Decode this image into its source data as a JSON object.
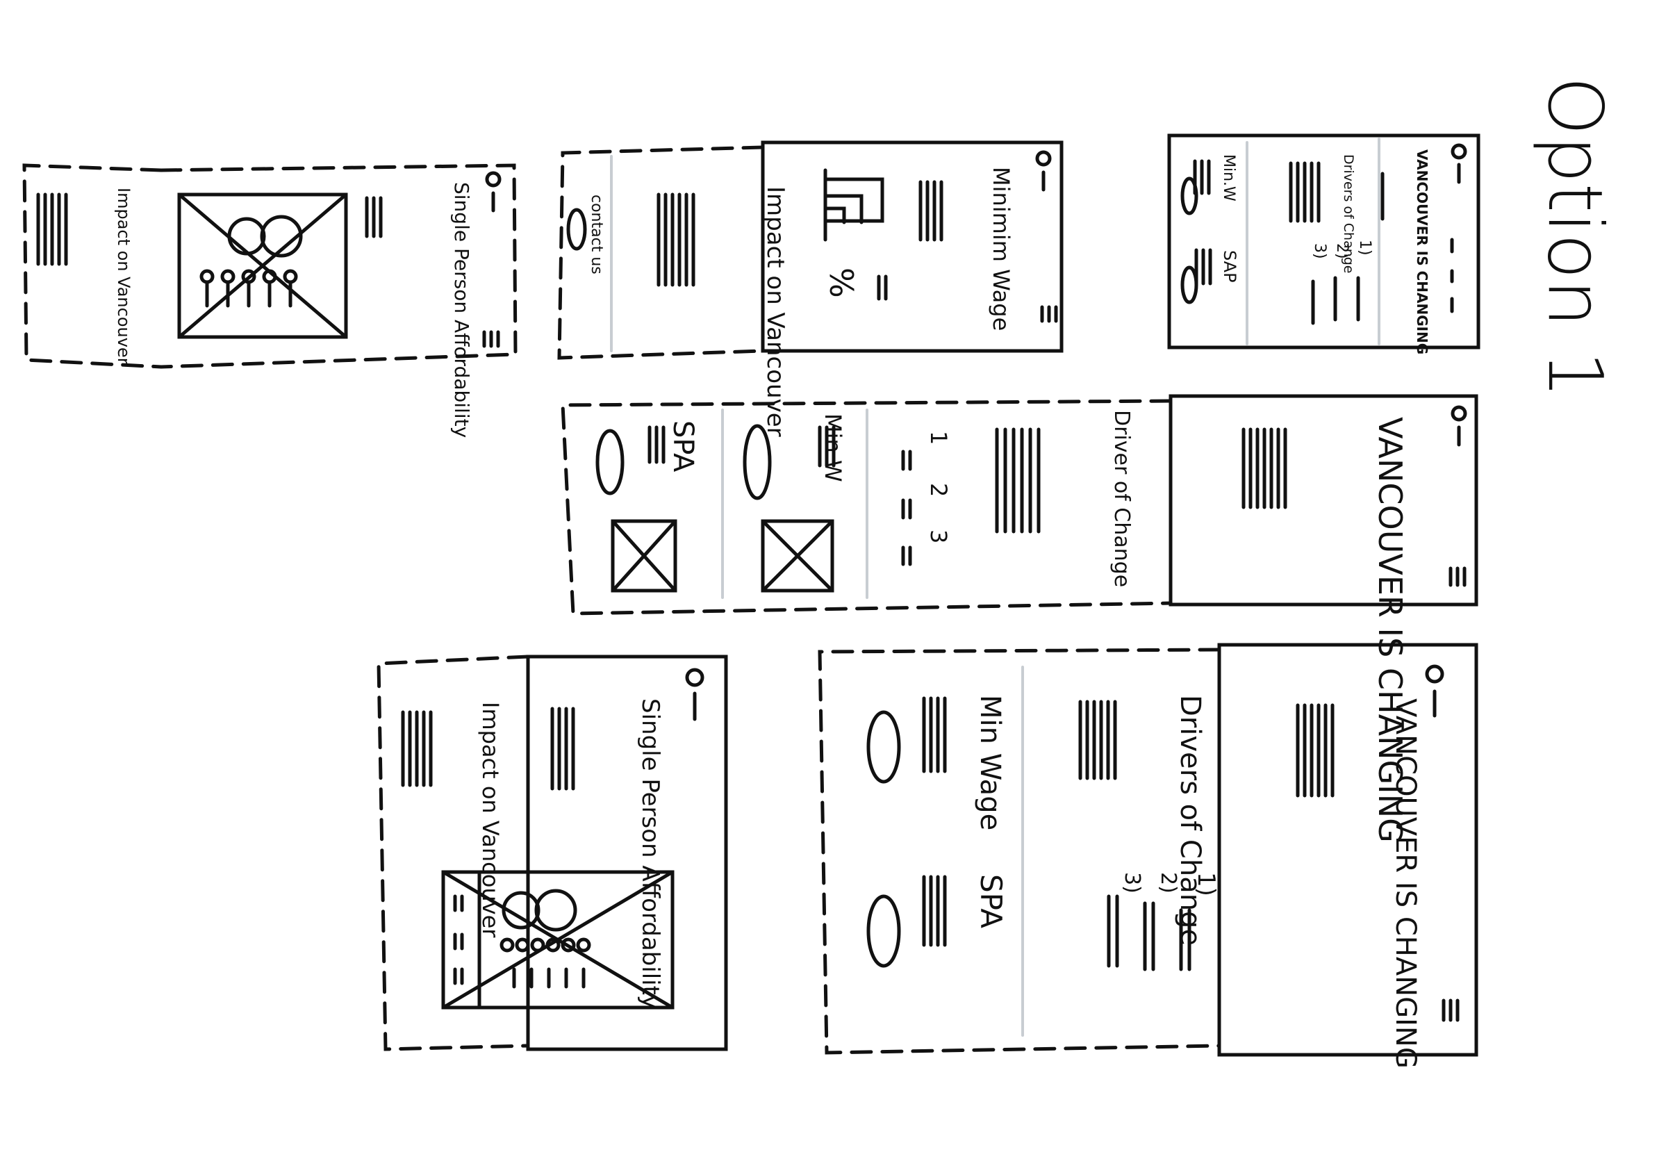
{
  "page": {
    "option_title": "Option 1"
  },
  "colors": {
    "ink": "#111111",
    "divider": "#c8cdd2",
    "paper": "#ffffff"
  },
  "icons": {
    "radio": "logo-circle-dash-icon",
    "menu": "hamburger-menu-icon",
    "image": "image-placeholder-icon"
  },
  "sketches": {
    "top_right": {
      "title": "VANCOUVER IS CHANGING",
      "drivers": "Drivers of Change",
      "num1": "1)",
      "num2": "2)",
      "num3": "3)",
      "minw": "Min.W",
      "sap": "SAP"
    },
    "top_middle": {
      "title": "Minimim Wage",
      "impact": "Impact on Vancouver",
      "percent": "%",
      "contact": "contact us"
    },
    "top_left": {
      "title": "Single Person Affordability",
      "impact": "Impact on Vancouver"
    },
    "middle": {
      "title": "VANCOUVER IS CHANGING",
      "driver": "Driver of Change",
      "num1": "1",
      "num2": "2",
      "num3": "3",
      "minw": "Min.W",
      "spa": "SPA"
    },
    "bottom_right": {
      "title": "VANCOUVER IS CHANGING",
      "drivers": "Drivers of Change",
      "num1": "1)",
      "num2": "2)",
      "num3": "3)",
      "minwage": "Min Wage",
      "spa": "SPA"
    },
    "bottom_left": {
      "title": "Single Person Affordability",
      "impact": "Impact on Vancouver"
    }
  }
}
